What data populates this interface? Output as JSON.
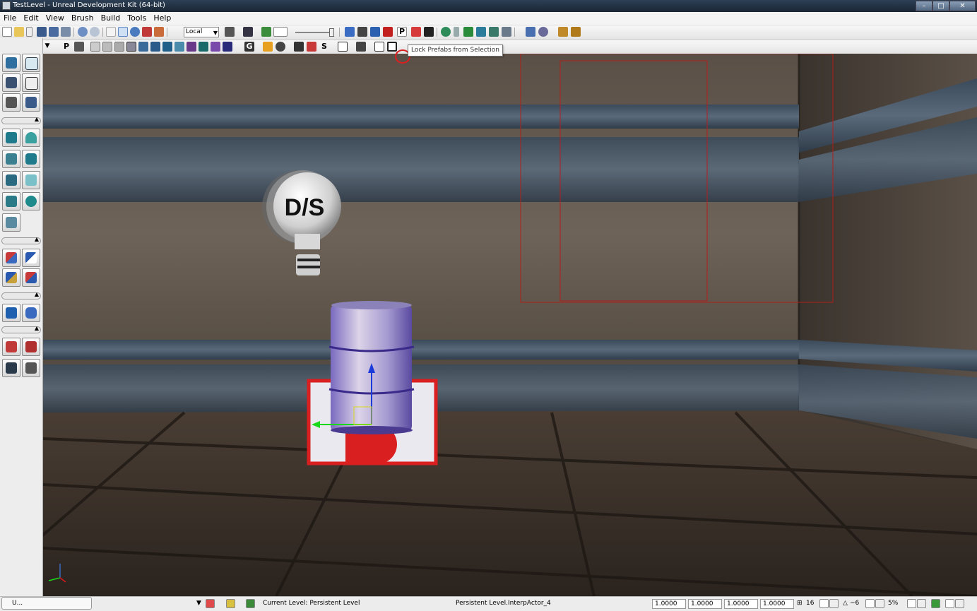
{
  "window": {
    "title": "TestLevel - Unreal Development Kit (64-bit)",
    "min": "–",
    "max": "□",
    "close": "✕"
  },
  "menu": [
    "File",
    "Edit",
    "View",
    "Brush",
    "Build",
    "Tools",
    "Help"
  ],
  "toolbar": {
    "coord_system": "Local",
    "arrow": "▼",
    "prefab_lock_label": "P",
    "tooltip": "Lock Prefabs from Selection"
  },
  "toolbar2": {
    "p_label": "P",
    "g_label": "G",
    "s_label": "S"
  },
  "viewport": {
    "sprite_label": "D/S",
    "icons": [
      "directional-light-sprite-icon",
      "player-start-icon",
      "barrel-mesh",
      "translate-gizmo"
    ]
  },
  "statusbar": {
    "tab_label": "U...",
    "current_level": "Current Level:  Persistent Level",
    "selected_actor": "Persistent Level.InterpActor_4",
    "drag_grid": [
      "1.0000",
      "1.0000",
      "1.0000",
      "1.0000"
    ],
    "grid_size": "16",
    "rotation_snap": "~6",
    "scale_snap": "5%"
  },
  "colors": {
    "accent_red": "#d91f1f",
    "viewport_bg": "#3a3530",
    "title_bar": "#1a2634"
  }
}
